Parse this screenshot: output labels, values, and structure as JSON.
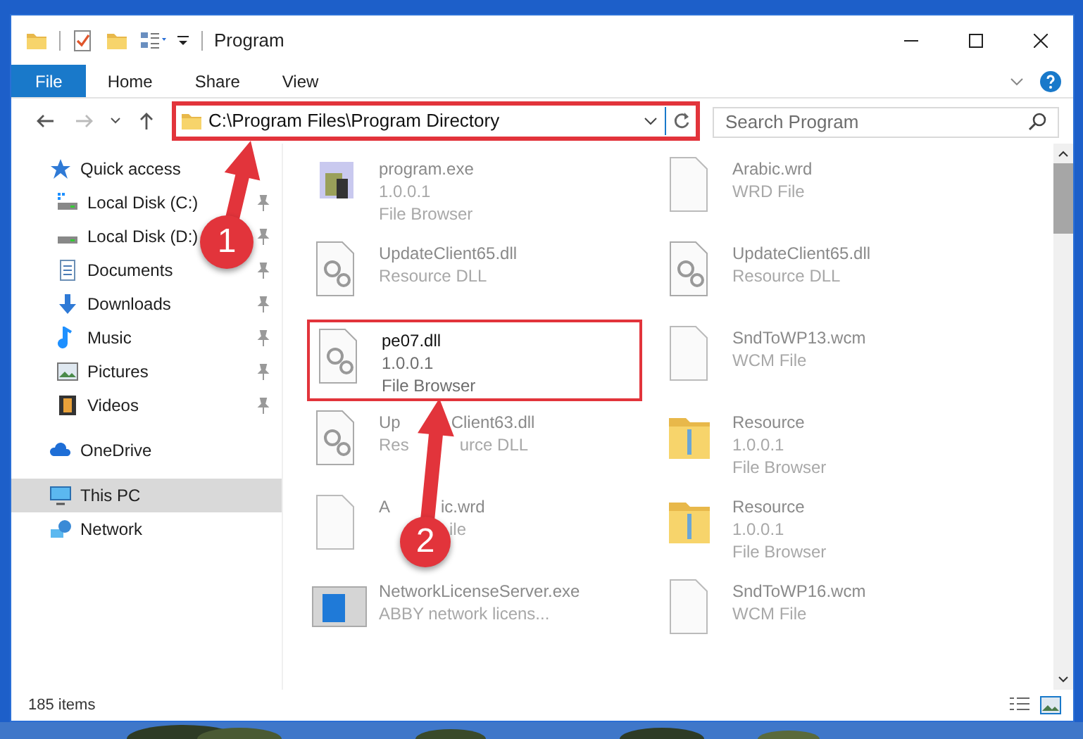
{
  "window": {
    "title": "Program"
  },
  "ribbon_tabs": [
    {
      "label": "File",
      "selected": true
    },
    {
      "label": "Home",
      "selected": false
    },
    {
      "label": "Share",
      "selected": false
    },
    {
      "label": "View",
      "selected": false
    }
  ],
  "address": {
    "path": "C:\\Program Files\\Program Directory",
    "highlighted": true
  },
  "search": {
    "placeholder": "Search Program"
  },
  "nav": [
    {
      "label": "Quick access",
      "kind": "star",
      "selected": false,
      "children": [
        {
          "label": "Local Disk (C:)",
          "kind": "disk-c",
          "pinned": true,
          "selected": false
        },
        {
          "label": "Local Disk (D:)",
          "kind": "disk",
          "pinned": true,
          "selected": false
        },
        {
          "label": "Documents",
          "kind": "docs",
          "pinned": true,
          "selected": false
        },
        {
          "label": "Downloads",
          "kind": "download",
          "pinned": true,
          "selected": false
        },
        {
          "label": "Music",
          "kind": "music",
          "pinned": true,
          "selected": false
        },
        {
          "label": "Pictures",
          "kind": "pictures",
          "pinned": true,
          "selected": false
        },
        {
          "label": "Videos",
          "kind": "videos",
          "pinned": true,
          "selected": false
        }
      ]
    },
    {
      "label": "OneDrive",
      "kind": "cloud",
      "selected": false
    },
    {
      "label": "This PC",
      "kind": "pc",
      "selected": true
    },
    {
      "label": "Network",
      "kind": "network",
      "selected": false
    }
  ],
  "files": [
    {
      "name": "program.exe",
      "lines": [
        "1.0.0.1",
        "File Browser"
      ],
      "kind": "exe",
      "highlighted": false
    },
    {
      "name": "Arabic.wrd",
      "lines": [
        "WRD File"
      ],
      "kind": "doc",
      "highlighted": false
    },
    {
      "name": "UpdateClient65.dll",
      "lines": [
        "Resource DLL"
      ],
      "kind": "dll",
      "highlighted": false
    },
    {
      "name": "UpdateClient65.dll",
      "lines": [
        "Resource DLL"
      ],
      "kind": "dll",
      "highlighted": false
    },
    {
      "name": "pe07.dll",
      "lines": [
        "1.0.0.1",
        "File Browser"
      ],
      "kind": "dll",
      "highlighted": true
    },
    {
      "name": "SndToWP13.wcm",
      "lines": [
        "WCM File"
      ],
      "kind": "doc",
      "highlighted": false
    },
    {
      "name": [
        "Up",
        "Client63.dll"
      ],
      "lines": [
        [
          "Res",
          "urce DLL"
        ]
      ],
      "kind": "dll",
      "highlighted": false
    },
    {
      "name": "Resource",
      "lines": [
        "1.0.0.1",
        "File Browser"
      ],
      "kind": "folder",
      "highlighted": false
    },
    {
      "name": [
        "A",
        "ic.wrd"
      ],
      "lines": [
        {
          "parts": [
            "ile"
          ],
          "lead_gap": true
        }
      ],
      "kind": "doc",
      "highlighted": false
    },
    {
      "name": "Resource",
      "lines": [
        "1.0.0.1",
        "File Browser"
      ],
      "kind": "folder",
      "highlighted": false
    },
    {
      "name": "NetworkLicenseServer.exe",
      "lines": [
        "ABBY network licens..."
      ],
      "kind": "app",
      "highlighted": false
    },
    {
      "name": "SndToWP16.wcm",
      "lines": [
        "WCM File"
      ],
      "kind": "doc",
      "highlighted": false
    }
  ],
  "status_bar": {
    "count": "185 items"
  },
  "annotations": [
    {
      "number": "1"
    },
    {
      "number": "2"
    }
  ]
}
